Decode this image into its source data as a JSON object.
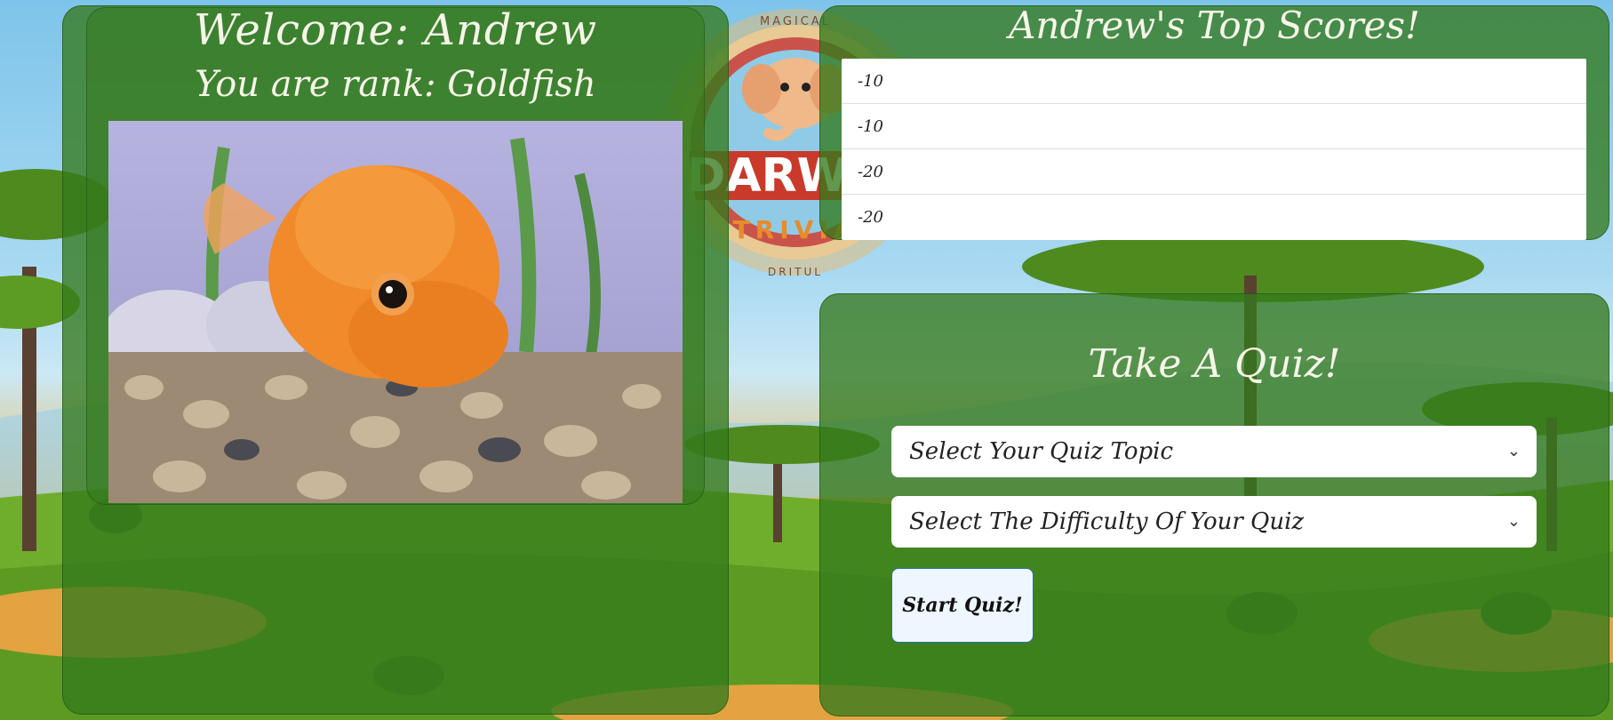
{
  "welcome": {
    "title": "Welcome: Andrew",
    "rank": "You are rank: Goldfish"
  },
  "scores": {
    "title": "Andrew's Top Scores!",
    "rows": [
      "-10",
      "-10",
      "-20",
      "-20"
    ]
  },
  "quiz": {
    "title": "Take A Quiz!",
    "topic_select": "Select Your Quiz Topic",
    "difficulty_select": "Select The Difficulty Of Your Quiz",
    "start_label": "Start Quiz!"
  },
  "logo": {
    "text_main": "DARWIN",
    "text_sub": "TRIVIA",
    "text_top": "MAGICAL",
    "text_bottom": "DRITUL"
  },
  "colors": {
    "panel_green": "#347a1c",
    "sky": "#7ec4ea",
    "ground": "#e2a340",
    "button_border": "#2a6fb3"
  }
}
